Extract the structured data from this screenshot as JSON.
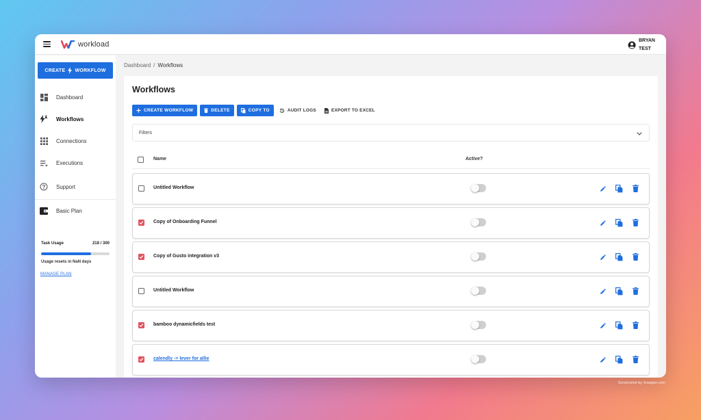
{
  "app": {
    "logo_text": "workload",
    "brand_color": "#1f6ee0",
    "logo_color": "#e2485e"
  },
  "user": {
    "first": "BRYAN",
    "last": "TEST",
    "icon": "account-circle-icon"
  },
  "sidebar": {
    "create_label_left": "CREATE",
    "create_label_right": "WORKFLOW",
    "items": [
      {
        "label": "Dashboard",
        "icon": "dashboard-icon"
      },
      {
        "label": "Workflows",
        "icon": "workflow-bolt-icon",
        "active": true
      },
      {
        "label": "Connections",
        "icon": "grid-dots-icon"
      },
      {
        "label": "Executions",
        "icon": "list-icon"
      },
      {
        "label": "Support",
        "icon": "help-circle-icon"
      }
    ],
    "plan": {
      "label": "Basic Plan",
      "usage_label": "Task Usage",
      "usage_value": "218 / 300",
      "usage_used": 218,
      "usage_total": 300,
      "reset_text": "Usage resets in NaN days",
      "manage_label": "MANAGE PLAN"
    }
  },
  "breadcrumb": {
    "root": "Dashboard",
    "separator": "/",
    "current": "Workflows"
  },
  "main": {
    "title": "Workflows",
    "toolbar": {
      "create": "CREATE WORKFLOW",
      "delete": "DELETE",
      "copy": "COPY TO",
      "audit": "AUDIT LOGS",
      "export": "EXPORT TO EXCEL"
    },
    "filters_label": "Filters",
    "columns": {
      "name": "Name",
      "active": "Active?"
    },
    "rows": [
      {
        "name": "Untitled Workflow",
        "checked": false,
        "active": false,
        "link": false
      },
      {
        "name": "Copy of Onboarding Funnel",
        "checked": true,
        "active": false,
        "link": false
      },
      {
        "name": "Copy of Gusto integration v3",
        "checked": true,
        "active": false,
        "link": false
      },
      {
        "name": "Untitled Workflow",
        "checked": false,
        "active": false,
        "link": false
      },
      {
        "name": "bamboo dynamicfields test",
        "checked": true,
        "active": false,
        "link": false
      },
      {
        "name": "calendly -> lever for allie",
        "checked": true,
        "active": false,
        "link": true
      }
    ]
  },
  "watermark": "Screenshot by Xnapper.com"
}
